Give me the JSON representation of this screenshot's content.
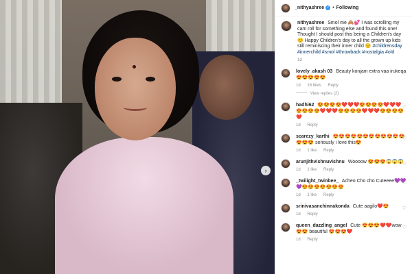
{
  "post": {
    "username": "_nithyashree",
    "verified_glyph": "✓",
    "follow_label": "Following",
    "separator": "•",
    "next_glyph": "›"
  },
  "caption": {
    "handle": "nithyashree",
    "text": "Smol me 🙈💕 I was scrolling my cam roll for something else and found this one! Thought I should post this being a Children's day 😊 Happy Children's day to all the grown up kids still reminiscing their inner child 😌",
    "hashtags": "#childrensday #innerchild #smol #throwback #nostalgia #old",
    "time": "1d"
  },
  "comments": [
    {
      "handle": "lovely_akash 03",
      "text": "Beauty konjam extra vaa irukeqa 😍😍😍😍😍",
      "time": "1d",
      "likes": "16 likes",
      "reply": "Reply",
      "view_replies": "View replies (2)"
    },
    {
      "handle": "hadhi62",
      "text": "😍😍😍😍❤️❤️❤️😍😍😍😍❤️❤️❤️😍😍😍😍❤️❤️❤️😍😍😍😍❤️❤️❤️😍😍😍😍❤️",
      "time": "1d",
      "likes": "",
      "reply": "Reply"
    },
    {
      "handle": "scarezy_karthi",
      "text": "😍😍😍😍😍😍😍😍😍😍😍😍😍😍😍 seriously i love this😍",
      "time": "1d",
      "likes": "1 like",
      "reply": "Reply"
    },
    {
      "handle": "arunjithvishnuvishnu",
      "text": "Woooow 😍😍😍😱😱😱",
      "time": "1d",
      "likes": "1 like",
      "reply": "Reply"
    },
    {
      "handle": "_twilight_twinbee_",
      "text": "Acheo Cho cho Cuteeee💜💜💜😍😍😍😍😍😍😍",
      "time": "1d",
      "likes": "1 like",
      "reply": "Reply"
    },
    {
      "handle": "srinivasanchinnakonda",
      "text": "Cute aagilo❤️😍",
      "time": "1d",
      "likes": "",
      "reply": "Reply"
    },
    {
      "handle": "queen_dazzling_angel",
      "text": "Cute 😍😍😍❤️❤️wow😍😍 beautiful 😍😍😍❤️",
      "time": "1d",
      "likes": "",
      "reply": "Reply"
    }
  ],
  "icons": {
    "heart": "♡"
  }
}
